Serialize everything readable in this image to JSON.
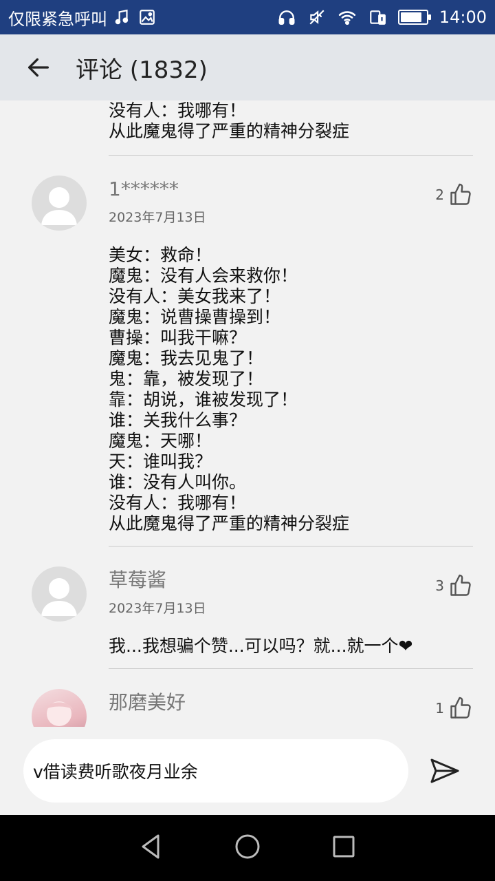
{
  "status_bar": {
    "left_text": "仅限紧急呼叫",
    "time": "14:00",
    "battery_level": 0.85,
    "icons": [
      "music-icon",
      "image-icon",
      "headphones-icon",
      "mute-icon",
      "wifi-icon",
      "sim-icon",
      "battery-icon"
    ]
  },
  "header": {
    "title": "评论 (1832)",
    "back_icon": "back-arrow-icon"
  },
  "partial_comment": {
    "text": "没有人：我哪有！\n从此魔鬼得了严重的精神分裂症"
  },
  "comments": [
    {
      "username": "1******",
      "date": "2023年7月13日",
      "likes": "2",
      "text": "美女：救命！\n魔鬼：没有人会来救你！\n没有人：美女我来了！\n魔鬼：说曹操曹操到！\n曹操：叫我干嘛？\n魔鬼：我去见鬼了！\n鬼：靠，被发现了！\n靠：胡说，谁被发现了！\n谁：关我什么事？\n魔鬼：天哪！\n 天：谁叫我？\n谁：没有人叫你。\n没有人：我哪有！\n从此魔鬼得了严重的精神分裂症"
    },
    {
      "username": "草莓酱",
      "date": "2023年7月13日",
      "likes": "3",
      "text": "我...我想骗个赞...可以吗？就...就一个❤"
    },
    {
      "username": "那磨美好",
      "likes": "1"
    }
  ],
  "input": {
    "value": "v借读费听歌夜月业余"
  },
  "colors": {
    "status_bar": "#1f3f80",
    "app_bar": "#e3e6ea",
    "background": "#f2f2f2"
  }
}
